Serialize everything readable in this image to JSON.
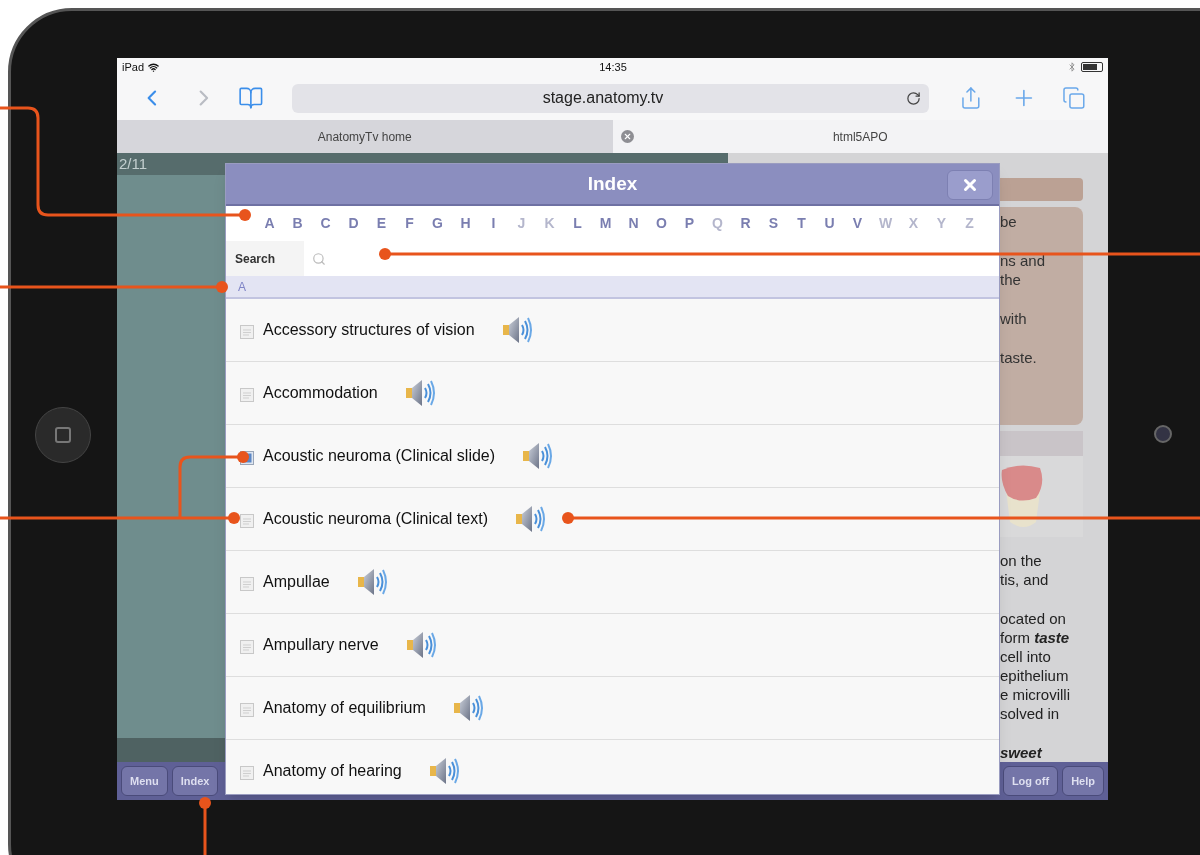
{
  "status_bar": {
    "carrier": "iPad",
    "time": "14:35"
  },
  "browser": {
    "url": "stage.anatomy.tv",
    "tabs": [
      {
        "label": "AnatomyTv home",
        "selected": false
      },
      {
        "label": "html5APO",
        "selected": true
      }
    ]
  },
  "page": {
    "counter": "2/11",
    "upper_paragraphs": [
      [
        "be"
      ],
      [
        "ns and",
        "the"
      ],
      [
        "with"
      ],
      [
        "taste."
      ]
    ],
    "lower_paragraphs": [
      {
        "lines": [
          "on the",
          "tis, and"
        ],
        "emphasis": false
      },
      {
        "lines": [
          "ocated on",
          "form **taste**",
          "cell into",
          "epithelium",
          "e microvilli",
          "solved in"
        ],
        "emphasis": false
      },
      {
        "lines": [
          "sweet"
        ],
        "emphasis": true
      }
    ]
  },
  "index_dialog": {
    "title": "Index",
    "letters": [
      {
        "label": "A",
        "available": true
      },
      {
        "label": "B",
        "available": true
      },
      {
        "label": "C",
        "available": true
      },
      {
        "label": "D",
        "available": true
      },
      {
        "label": "E",
        "available": true
      },
      {
        "label": "F",
        "available": true
      },
      {
        "label": "G",
        "available": true
      },
      {
        "label": "H",
        "available": true
      },
      {
        "label": "I",
        "available": true
      },
      {
        "label": "J",
        "available": false
      },
      {
        "label": "K",
        "available": false
      },
      {
        "label": "L",
        "available": true
      },
      {
        "label": "M",
        "available": true
      },
      {
        "label": "N",
        "available": true
      },
      {
        "label": "O",
        "available": true
      },
      {
        "label": "P",
        "available": true
      },
      {
        "label": "Q",
        "available": false
      },
      {
        "label": "R",
        "available": true
      },
      {
        "label": "S",
        "available": true
      },
      {
        "label": "T",
        "available": true
      },
      {
        "label": "U",
        "available": true
      },
      {
        "label": "V",
        "available": true
      },
      {
        "label": "W",
        "available": false
      },
      {
        "label": "X",
        "available": false
      },
      {
        "label": "Y",
        "available": false
      },
      {
        "label": "Z",
        "available": false
      }
    ],
    "search": {
      "label": "Search"
    },
    "section": "A",
    "entries": [
      {
        "label": "Accessory structures of vision",
        "kind": "text"
      },
      {
        "label": "Accommodation",
        "kind": "text"
      },
      {
        "label": "Acoustic neuroma (Clinical slide)",
        "kind": "slide"
      },
      {
        "label": "Acoustic neuroma (Clinical text)",
        "kind": "text"
      },
      {
        "label": "Ampullae",
        "kind": "text"
      },
      {
        "label": "Ampullary nerve",
        "kind": "text"
      },
      {
        "label": "Anatomy of equilibrium",
        "kind": "text"
      },
      {
        "label": "Anatomy of hearing",
        "kind": "text"
      }
    ]
  },
  "bottom_bar": {
    "left_buttons": [
      "Menu",
      "Index"
    ],
    "right_buttons": [
      "Log off",
      "Help"
    ]
  }
}
